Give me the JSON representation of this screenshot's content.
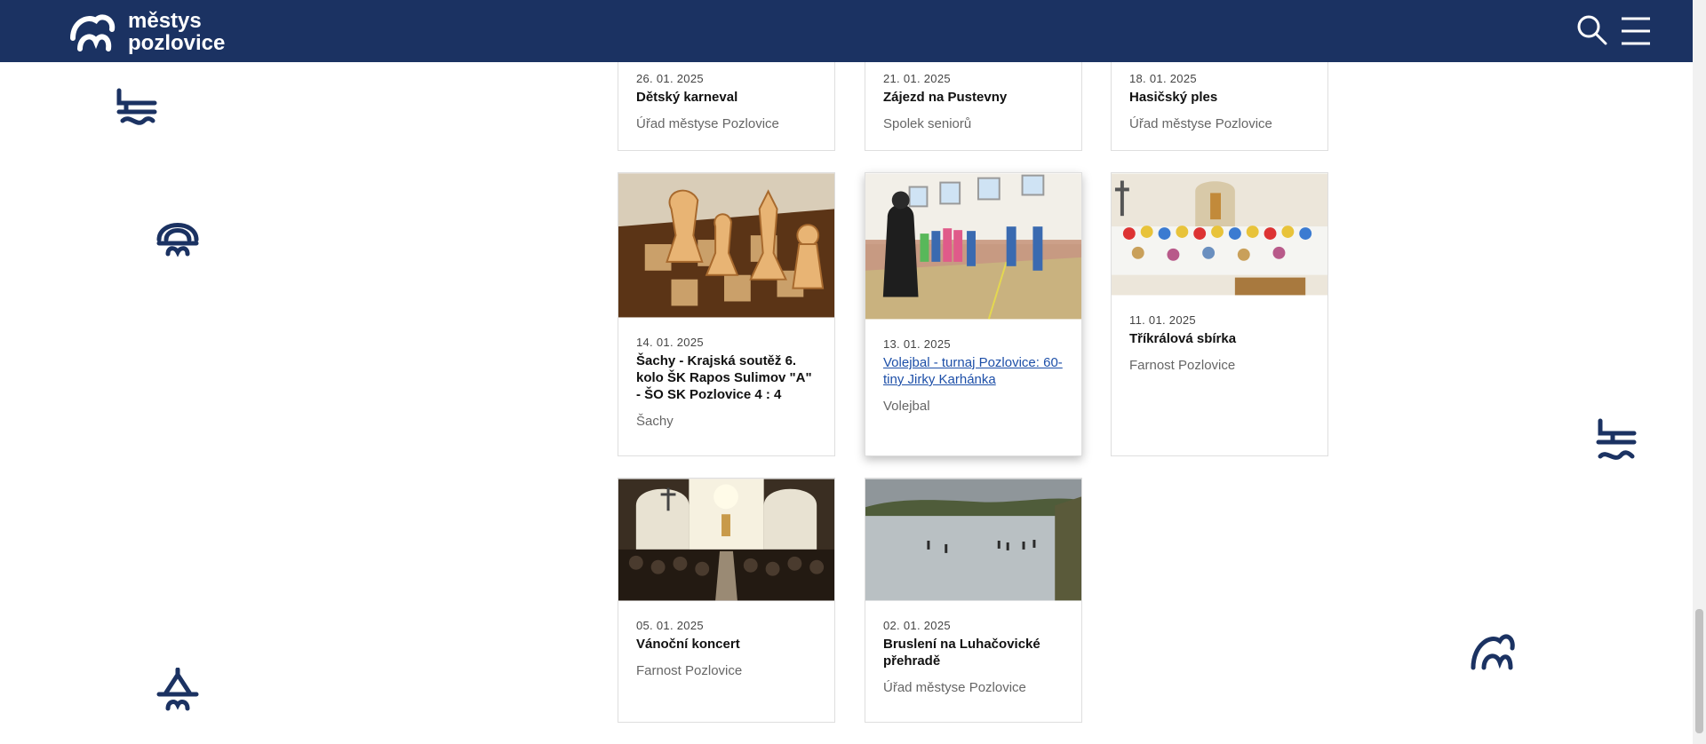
{
  "site": {
    "logo_line1": "městys",
    "logo_line2": "pozlovice"
  },
  "colors": {
    "header_bg": "#1b3262",
    "link": "#1d4fa8",
    "icon_blue": "#1b3262"
  },
  "header": {
    "search_icon": "search-icon",
    "menu_icon": "hamburger-menu-icon"
  },
  "cards": [
    {
      "date": "26. 01. 2025",
      "title": "Dětský karneval",
      "category": "Úřad městyse Pozlovice"
    },
    {
      "date": "21. 01. 2025",
      "title": "Zájezd na Pustevny",
      "category": "Spolek seniorů"
    },
    {
      "date": "18. 01. 2025",
      "title": "Hasičský ples",
      "category": "Úřad městyse Pozlovice"
    },
    {
      "date": "14. 01. 2025",
      "title": "Šachy - Krajská soutěž 6. kolo ŠK Rapos Sulimov \"A\" - ŠO SK Pozlovice 4 : 4",
      "category": "Šachy",
      "image": "chess-pieces-photo"
    },
    {
      "date": "13. 01. 2025",
      "title": "Volejbal - turnaj Pozlovice: 60-tiny Jirky Karhánka",
      "category": "Volejbal",
      "image": "gym-volleyball-photo"
    },
    {
      "date": "11. 01. 2025",
      "title": "Tříkrálová sbírka",
      "category": "Farnost Pozlovice",
      "image": "church-carolers-photo"
    },
    {
      "date": "05. 01. 2025",
      "title": "Vánoční koncert",
      "category": "Farnost Pozlovice",
      "image": "church-concert-photo"
    },
    {
      "date": "02. 01. 2025",
      "title": "Bruslení na Luhačovické přehradě",
      "category": "Úřad městyse Pozlovice",
      "image": "ice-skating-lake-photo"
    }
  ]
}
